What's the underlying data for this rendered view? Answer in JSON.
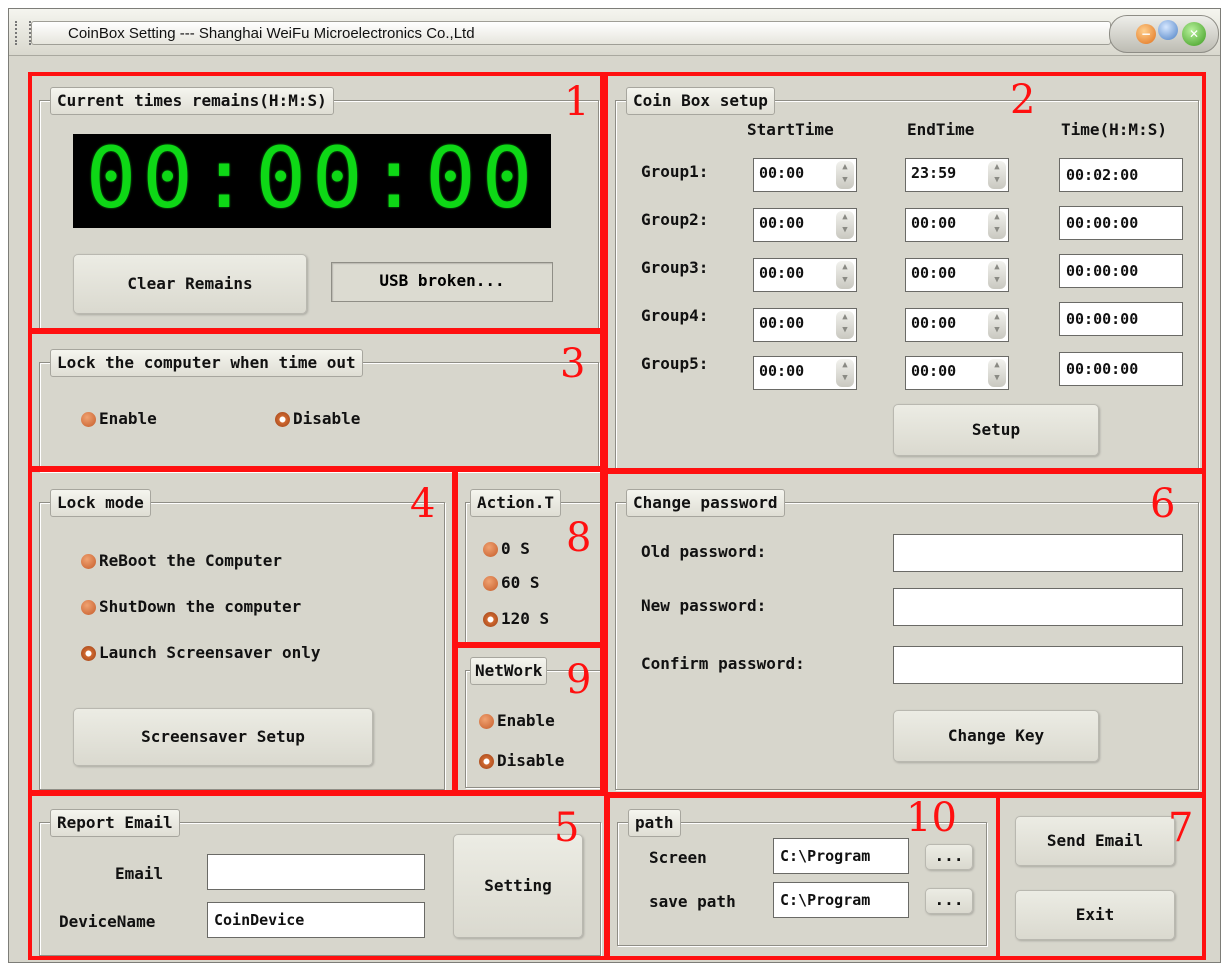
{
  "window": {
    "title": "CoinBox Setting --- Shanghai WeiFu Microelectronics Co.,Ltd"
  },
  "annotations": {
    "n1": "1",
    "n2": "2",
    "n3": "3",
    "n4": "4",
    "n5": "5",
    "n6": "6",
    "n7": "7",
    "n8": "8",
    "n9": "9",
    "n10": "10",
    "color": "#ff1010"
  },
  "remains": {
    "title": "Current times remains(H:M:S)",
    "time": "00:00:00",
    "clear_label": "Clear Remains",
    "status": "USB broken..."
  },
  "coinbox": {
    "title": "Coin Box setup",
    "headers": [
      "StartTime",
      "EndTime",
      "Time(H:M:S)"
    ],
    "groups": [
      {
        "label": "Group1:",
        "start": "00:00",
        "end": "23:59",
        "time": "00:02:00"
      },
      {
        "label": "Group2:",
        "start": "00:00",
        "end": "00:00",
        "time": "00:00:00"
      },
      {
        "label": "Group3:",
        "start": "00:00",
        "end": "00:00",
        "time": "00:00:00"
      },
      {
        "label": "Group4:",
        "start": "00:00",
        "end": "00:00",
        "time": "00:00:00"
      },
      {
        "label": "Group5:",
        "start": "00:00",
        "end": "00:00",
        "time": "00:00:00"
      }
    ],
    "setup_label": "Setup"
  },
  "lockcomputer": {
    "title": "Lock the computer when time out",
    "enable_label": "Enable",
    "disable_label": "Disable",
    "selected": "Disable"
  },
  "lockmode": {
    "title": "Lock mode",
    "options": [
      "ReBoot the Computer",
      "ShutDown the computer",
      "Launch Screensaver only"
    ],
    "selected": "Launch Screensaver only",
    "screensaver_label": "Screensaver Setup"
  },
  "action": {
    "title": "Action.T",
    "options": [
      "0 S",
      "60 S",
      "120 S"
    ],
    "selected": "120 S"
  },
  "network": {
    "title": "NetWork",
    "enable_label": "Enable",
    "disable_label": "Disable",
    "selected": "Disable"
  },
  "password": {
    "title": "Change password",
    "old_label": "Old password:",
    "new_label": "New password:",
    "confirm_label": "Confirm password:",
    "old_value": "",
    "new_value": "",
    "confirm_value": "",
    "change_label": "Change Key"
  },
  "report": {
    "title": "Report Email",
    "email_label": "Email",
    "email_value": "",
    "device_label": "DeviceName",
    "device_value": "CoinDevice",
    "setting_label": "Setting"
  },
  "path": {
    "title": "path",
    "screen_label": "Screen",
    "screen_value": "C:\\Program",
    "save_label": "save path",
    "save_value": "C:\\Program",
    "browse_label": "..."
  },
  "actions": {
    "send_email_label": "Send Email",
    "exit_label": "Exit"
  }
}
